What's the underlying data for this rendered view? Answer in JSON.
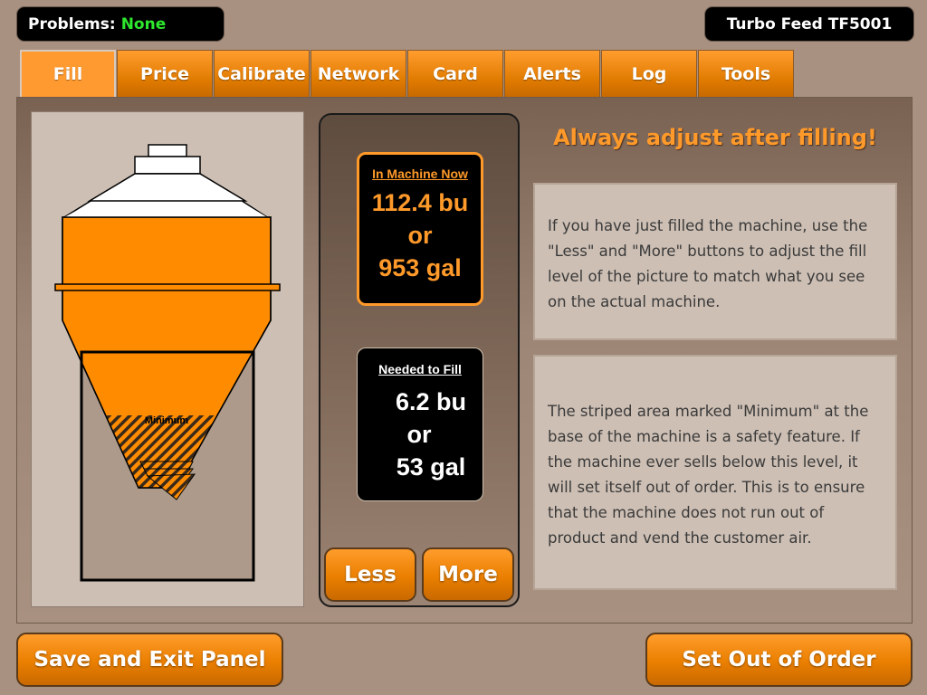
{
  "header": {
    "problems_label": "Problems:",
    "problems_value": "None",
    "model": "Turbo Feed TF5001"
  },
  "tabs": [
    {
      "label": "Fill",
      "active": true
    },
    {
      "label": "Price",
      "active": false
    },
    {
      "label": "Calibrate",
      "active": false
    },
    {
      "label": "Network",
      "active": false
    },
    {
      "label": "Card",
      "active": false
    },
    {
      "label": "Alerts",
      "active": false
    },
    {
      "label": "Log",
      "active": false
    },
    {
      "label": "Tools",
      "active": false
    }
  ],
  "machine": {
    "minimum_label": "Minimum",
    "fill_color": "#ff8c00"
  },
  "readouts": {
    "now": {
      "label": "In Machine Now",
      "bu": "112.4 bu",
      "or": "or",
      "gal": "953 gal"
    },
    "needed": {
      "label": "Needed to Fill",
      "bu": "6.2 bu",
      "or": "or",
      "gal": "53 gal"
    }
  },
  "controls": {
    "less": "Less",
    "more": "More"
  },
  "help": {
    "headline": "Always adjust after filling!",
    "paragraph1": "If you have just filled the machine, use the \"Less\" and \"More\" buttons to adjust the fill level of the picture to match what you see on the actual machine.",
    "paragraph2": "The striped area marked \"Minimum\" at the base of the machine is a safety feature. If the machine ever sells below this level, it will set itself out of order. This is to ensure that the machine does not run out of product and vend the customer air."
  },
  "footer": {
    "save": "Save and Exit Panel",
    "out_of_order": "Set Out of Order"
  },
  "colors": {
    "accent": "#ff9a2a",
    "background": "#a89180",
    "ok": "#2ee82e"
  }
}
